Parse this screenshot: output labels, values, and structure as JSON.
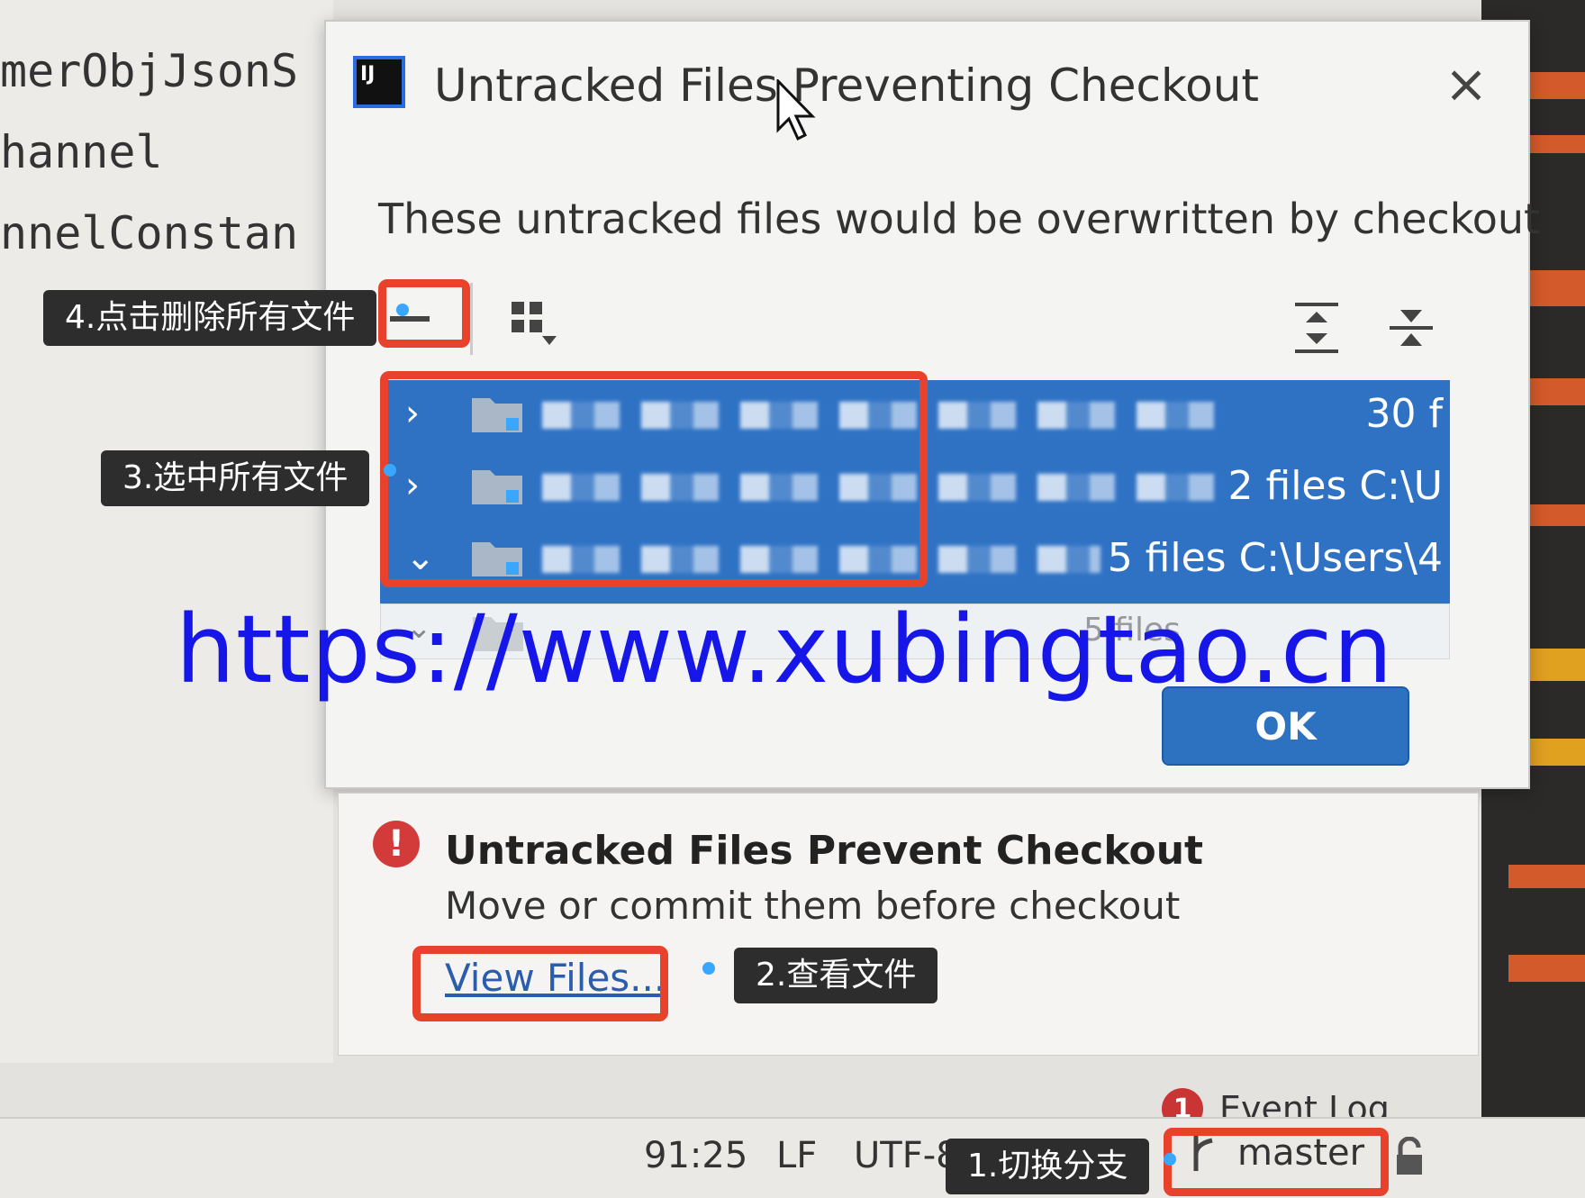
{
  "editor": {
    "lines": [
      "merObjJsonS",
      "hannel",
      "nnelConstan"
    ]
  },
  "dialog": {
    "title": "Untracked Files Preventing Checkout",
    "message": "These untracked files would be overwritten by checkout",
    "close_icon": "close-icon",
    "toolbar": {
      "remove_icon": "minus-icon",
      "group_icon": "group-by-icon",
      "expand_icon": "expand-all-icon",
      "collapse_icon": "collapse-all-icon"
    },
    "rows": [
      {
        "chevron": "›",
        "info": "30 f"
      },
      {
        "chevron": "›",
        "info": "2 files  C:\\U"
      },
      {
        "chevron": "⌄",
        "info": "5 files  C:\\Users\\4"
      }
    ],
    "lower_row_info": "5 files",
    "ok_label": "OK"
  },
  "notification": {
    "title": "Untracked Files Prevent Checkout",
    "body": "Move or commit them before checkout",
    "link": "View Files..."
  },
  "statusbar": {
    "position": "91:25",
    "line_sep": "LF",
    "encoding": "UTF-8",
    "branch": "master",
    "event_log_count": "1",
    "event_log_label": "Event Log"
  },
  "annotations": {
    "step1": "1.切换分支",
    "step2": "2.查看文件",
    "step3": "3.选中所有文件",
    "step4": "4.点击删除所有文件"
  },
  "watermark": "https://www.xubingtao.cn",
  "colors": {
    "accent": "#2f72c4",
    "highlight": "#e8412c",
    "callout_bg": "#2d2d2d",
    "watermark": "#1616e8"
  }
}
